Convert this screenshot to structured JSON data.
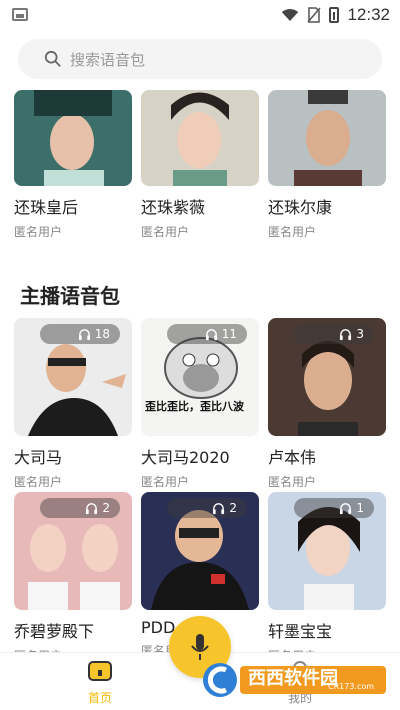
{
  "status_bar": {
    "time": "12:32"
  },
  "search": {
    "placeholder": "搜索语音包"
  },
  "top_row": [
    {
      "name": "还珠皇后",
      "user": "匿名用户"
    },
    {
      "name": "还珠紫薇",
      "user": "匿名用户"
    },
    {
      "name": "还珠尔康",
      "user": "匿名用户"
    }
  ],
  "section": {
    "title": "主播语音包"
  },
  "anchor_cards": [
    {
      "name": "大司马",
      "user": "匿名用户",
      "count": "18"
    },
    {
      "name": "大司马2020",
      "user": "匿名用户",
      "count": "11",
      "caption": "歪比歪比，歪比八波"
    },
    {
      "name": "卢本伟",
      "user": "匿名用户",
      "count": "3"
    },
    {
      "name": "乔碧萝殿下",
      "user": "匿名用户",
      "count": "2"
    },
    {
      "name": "PDD",
      "user": "匿名用户",
      "count": "2"
    },
    {
      "name": "轩墨宝宝",
      "user": "匿名用户",
      "count": "1"
    }
  ],
  "tabbar": {
    "home_label": "首页",
    "me_label": "我的"
  },
  "watermark": {
    "text": "西西软件园",
    "url_text": "CR173.com"
  },
  "colors": {
    "accent": "#f7c52b",
    "home_tab": "#f2b800"
  },
  "icons": [
    "image-icon",
    "wifi-icon",
    "no-sim-icon",
    "battery-icon",
    "search-icon",
    "headphones-icon",
    "home-icon",
    "microphone-icon"
  ]
}
